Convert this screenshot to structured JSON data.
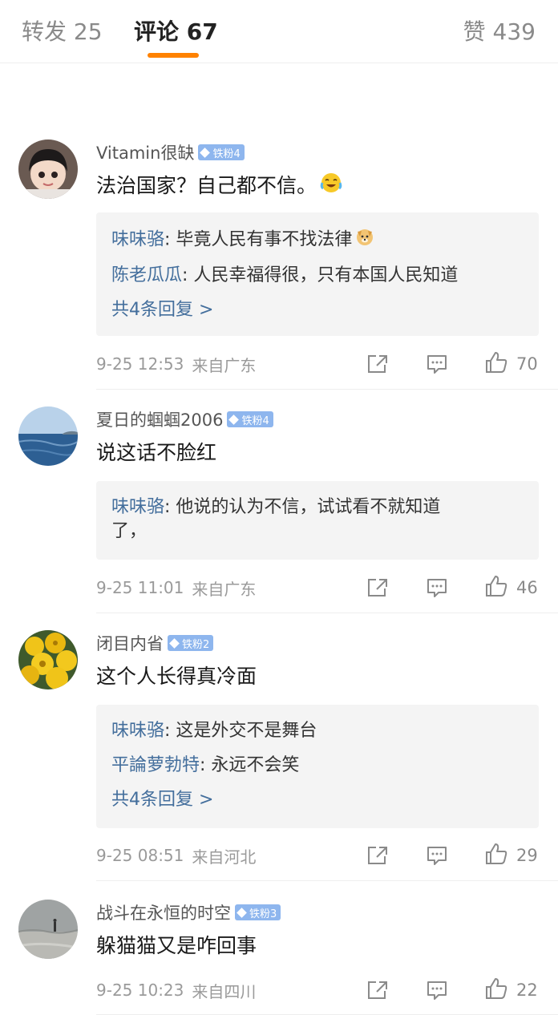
{
  "tabs": {
    "repost": "转发 25",
    "comments": "评论 67",
    "likes": "赞 439"
  },
  "comments": [
    {
      "user": "Vitamin很缺",
      "badge": "铁粉4",
      "text": "法治国家？自己都不信。",
      "emoji": "laugh-cry-emoji",
      "replies": [
        {
          "name": "味味骆",
          "text": ": 毕竟人民有事不找法律",
          "emoji": "doge-emoji"
        },
        {
          "name": "陈老瓜瓜",
          "text": ": 人民幸福得很，只有本国人民知道"
        }
      ],
      "more": "共4条回复 >",
      "time": "9-25 12:53",
      "location": "来自广东",
      "likes": "70"
    },
    {
      "user": "夏日的蝈蝈2006",
      "badge": "铁粉4",
      "text": "说这话不脸红",
      "replies": [
        {
          "name": "味味骆",
          "text": ": 他说的认为不信，试试看不就知道",
          "continuation": "了，"
        }
      ],
      "time": "9-25 11:01",
      "location": "来自广东",
      "likes": "46"
    },
    {
      "user": "闭目内省",
      "badge": "铁粉2",
      "text": "这个人长得真冷面",
      "replies": [
        {
          "name": "味味骆",
          "text": ": 这是外交不是舞台"
        },
        {
          "name": "平論萝勃特",
          "text": ": 永远不会笑"
        }
      ],
      "more": "共4条回复 >",
      "time": "9-25 08:51",
      "location": "来自河北",
      "likes": "29"
    },
    {
      "user": "战斗在永恒的时空",
      "badge": "铁粉3",
      "text": "躲猫猫又是咋回事",
      "time": "9-25 10:23",
      "location": "来自四川",
      "likes": "22"
    }
  ],
  "colors": {
    "accent": "#ff8200",
    "link": "#436e9c",
    "badge": "#8eb6ee",
    "reply_bg": "#f4f4f4"
  }
}
